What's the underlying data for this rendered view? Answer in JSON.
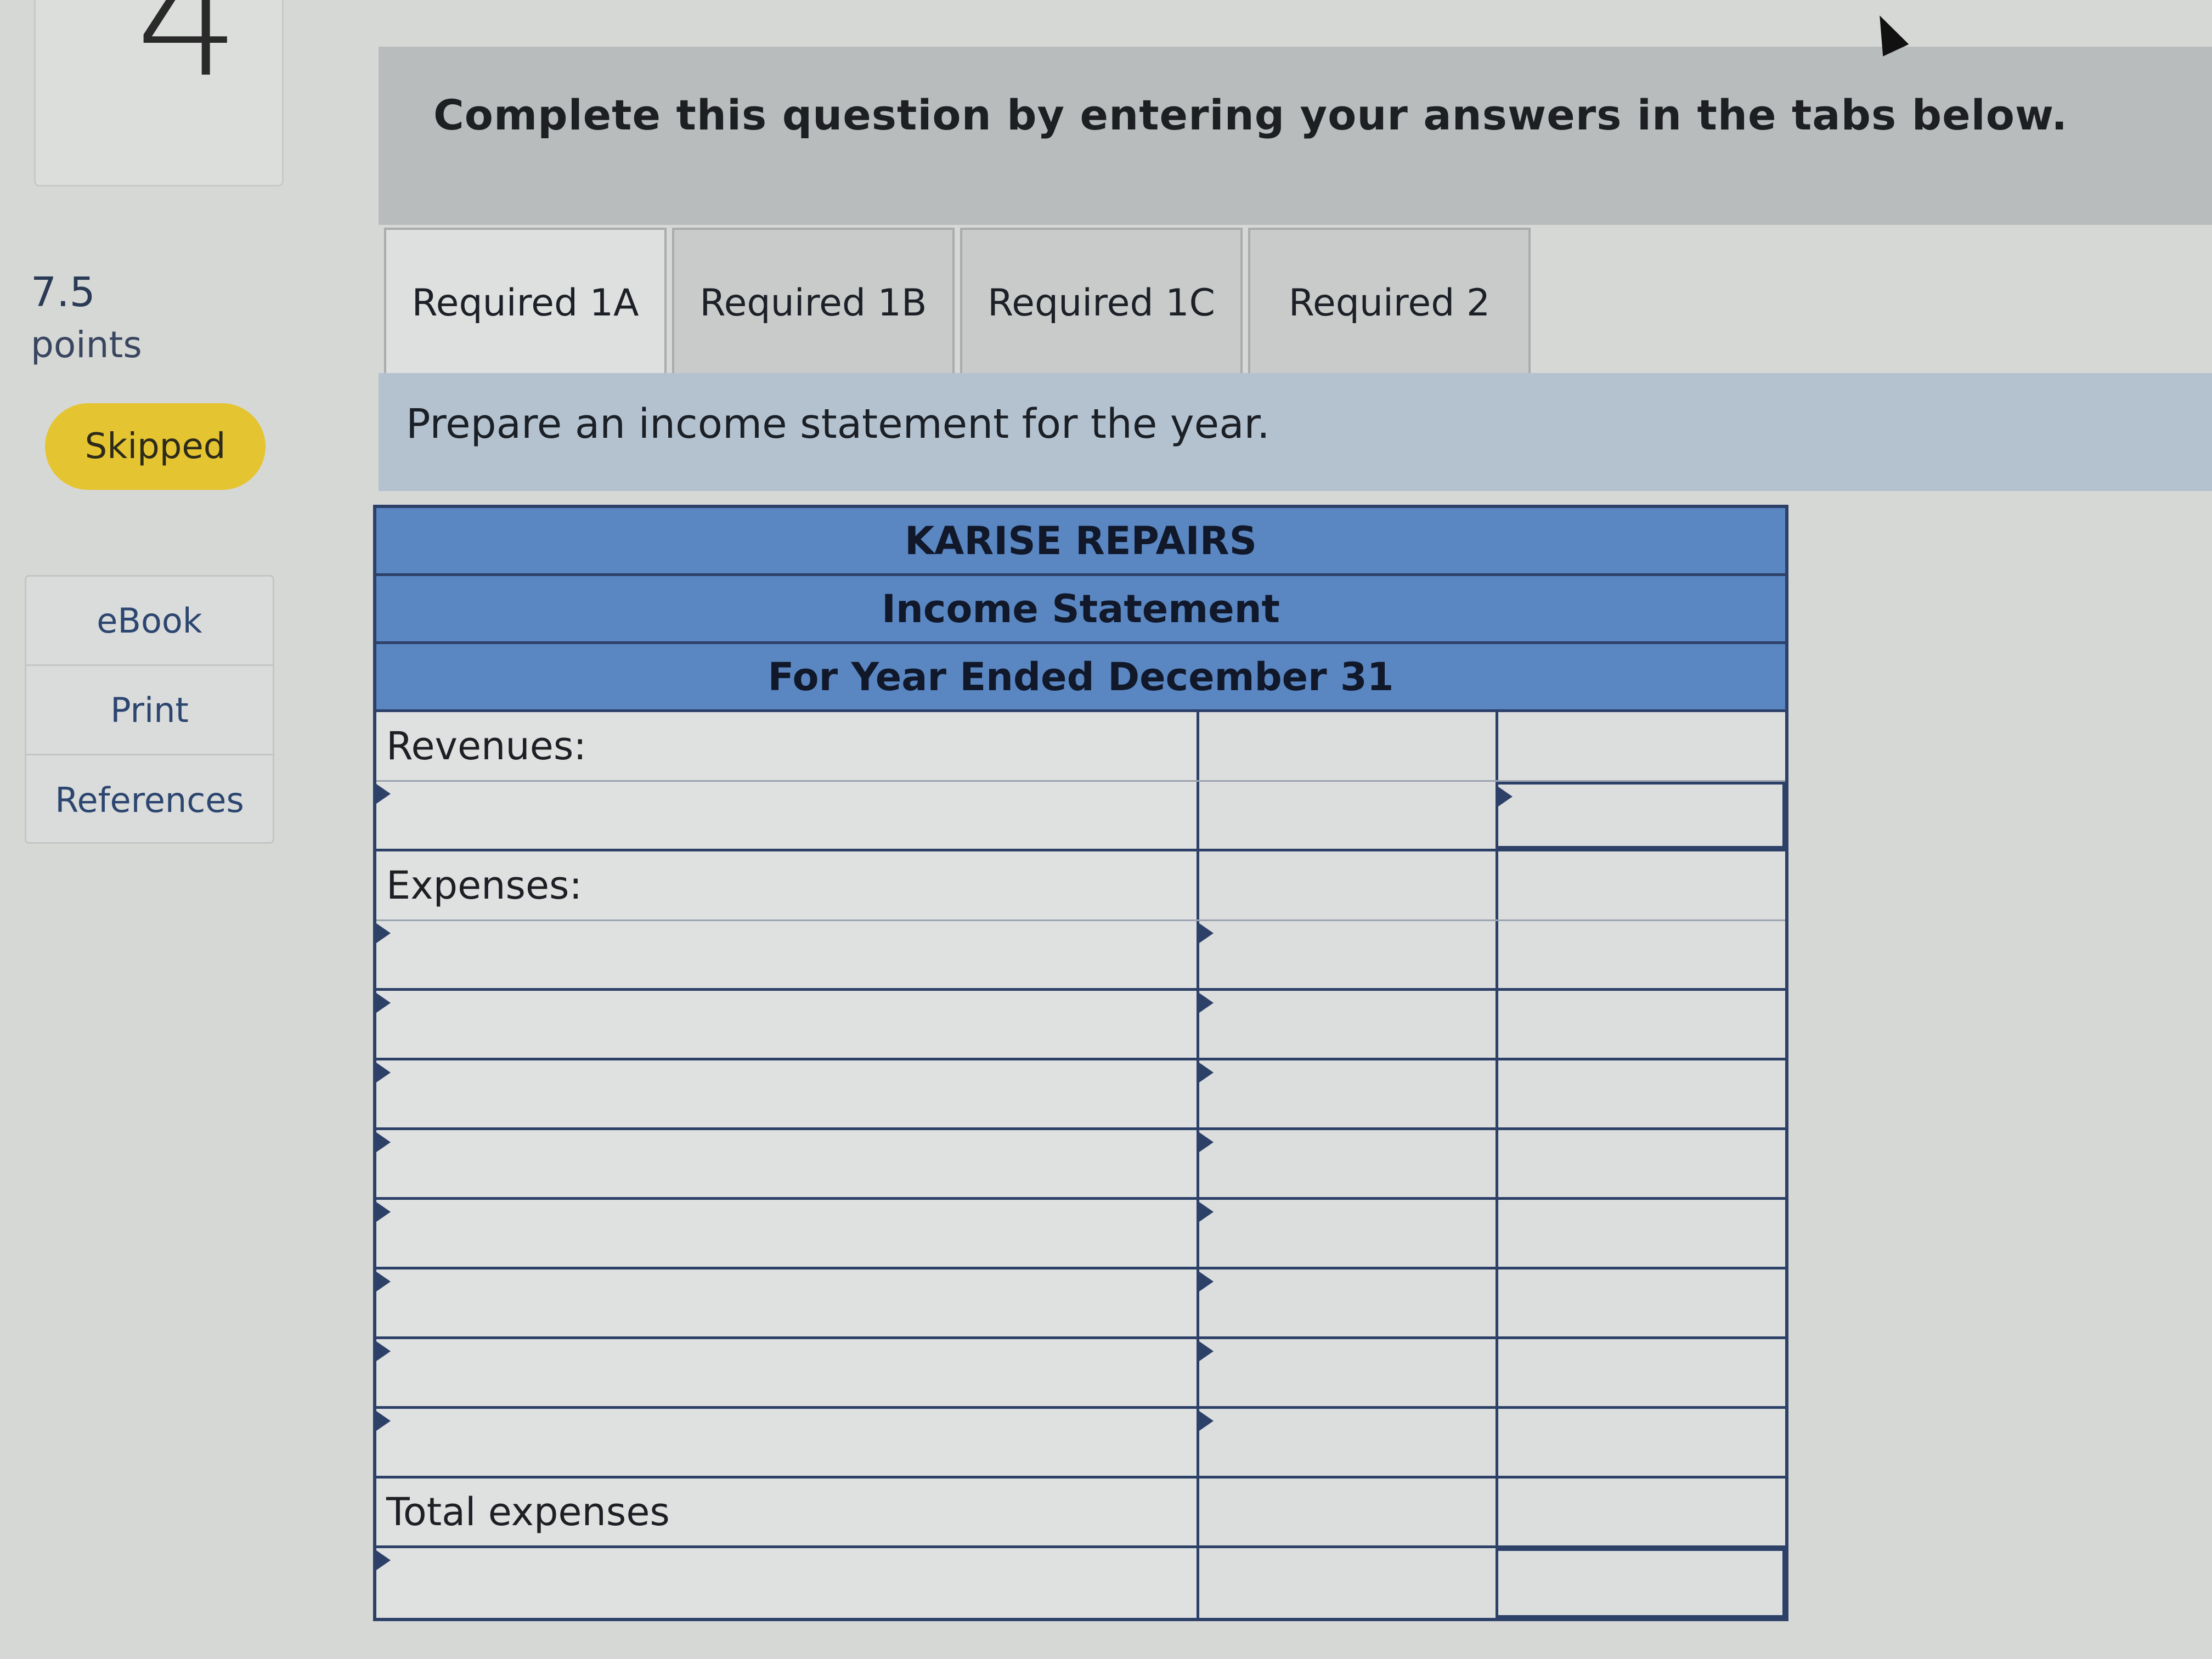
{
  "sidebar": {
    "question_number": "4",
    "points_value": "7.5",
    "points_label": "points",
    "status_badge": "Skipped",
    "menu": [
      "eBook",
      "Print",
      "References"
    ]
  },
  "banner": {
    "instruction": "Complete this question by entering your answers in the tabs below."
  },
  "tabs": [
    {
      "label": "Required 1A",
      "active": true
    },
    {
      "label": "Required 1B",
      "active": false
    },
    {
      "label": "Required 1C",
      "active": false
    },
    {
      "label": "Required 2",
      "active": false
    }
  ],
  "prompt": "Prepare an income statement for the year.",
  "statement": {
    "company": "KARISE REPAIRS",
    "title": "Income Statement",
    "period": "For Year Ended December 31",
    "revenues_label": "Revenues:",
    "expenses_label": "Expenses:",
    "total_expenses_label": "Total expenses"
  },
  "colors": {
    "header_blue": "#5a86c2",
    "border_navy": "#2d4068",
    "badge_yellow": "#e5c431",
    "prompt_strip": "#b4c2d0"
  }
}
